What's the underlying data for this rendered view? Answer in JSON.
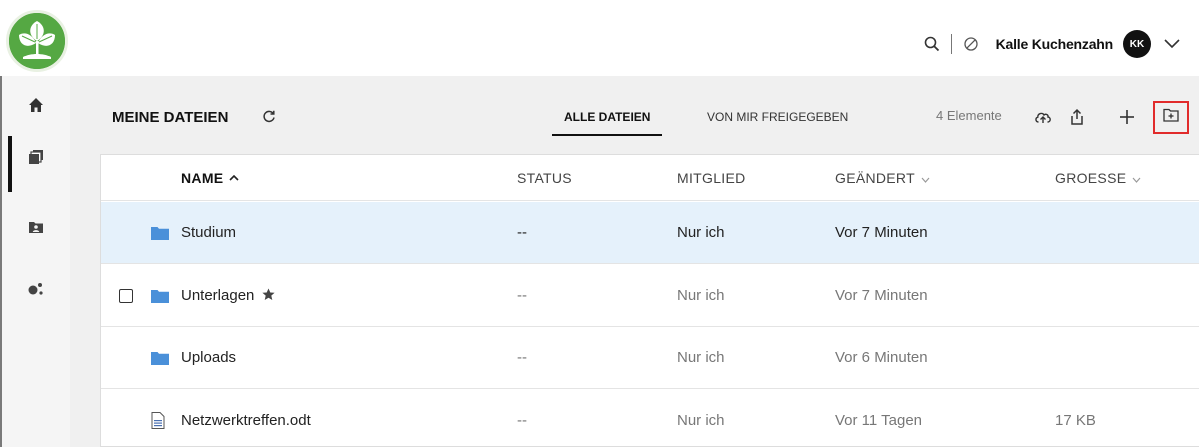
{
  "header": {
    "username": "Kalle Kuchenzahn",
    "avatar_initials": "KK",
    "icons": [
      "search-icon",
      "status-icon",
      "chevron-down-icon"
    ]
  },
  "sidebar": {
    "items": [
      {
        "id": "home",
        "icon": "home-icon"
      },
      {
        "id": "files",
        "icon": "files-icon",
        "active": true
      },
      {
        "id": "shared",
        "icon": "shared-folder-icon"
      },
      {
        "id": "network",
        "icon": "network-icon"
      }
    ]
  },
  "toolbar": {
    "title": "MEINE DATEIEN",
    "tabs": [
      {
        "label": "ALLE DATEIEN",
        "active": true
      },
      {
        "label": "VON MIR FREIGEGEBEN",
        "active": false
      }
    ],
    "count": "4 Elemente",
    "icons": [
      "cloud-upload-icon",
      "share-upload-icon",
      "plus-icon",
      "new-folder-icon"
    ]
  },
  "table": {
    "columns": {
      "name": "NAME",
      "status": "STATUS",
      "member": "MITGLIED",
      "changed": "GEÄNDERT",
      "size": "GROESSE"
    },
    "rows": [
      {
        "name": "Studium",
        "type": "folder",
        "status": "--",
        "member": "Nur ich",
        "changed": "Vor 7 Minuten",
        "size": "",
        "selected": true
      },
      {
        "name": "Unterlagen",
        "type": "folder",
        "status": "--",
        "member": "Nur ich",
        "changed": "Vor 7 Minuten",
        "size": "",
        "favorite": true,
        "hover": true
      },
      {
        "name": "Uploads",
        "type": "folder",
        "status": "--",
        "member": "Nur ich",
        "changed": "Vor 6 Minuten",
        "size": ""
      },
      {
        "name": "Netzwerktreffen.odt",
        "type": "document",
        "status": "--",
        "member": "Nur ich",
        "changed": "Vor 11 Tagen",
        "size": "17 KB"
      }
    ]
  },
  "colors": {
    "selected_row": "#e5f1fb",
    "folder": "#4a90d9",
    "highlight_box": "#e12b2b",
    "brand_green": "#4a9a3a"
  }
}
